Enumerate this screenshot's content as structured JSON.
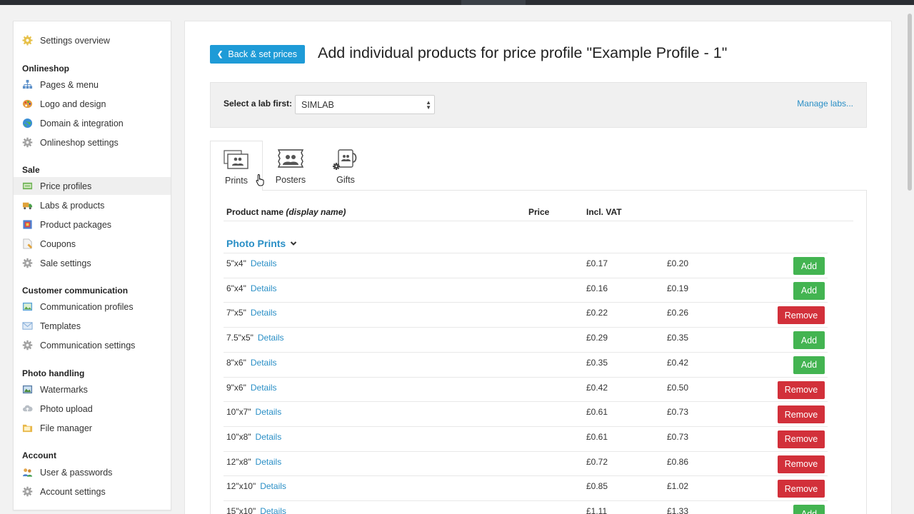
{
  "sidebar": {
    "overview": "Settings overview",
    "sections": {
      "onlineshop": "Onlineshop",
      "sale": "Sale",
      "customer_communication": "Customer communication",
      "photo_handling": "Photo handling",
      "account": "Account"
    },
    "items": {
      "pages_menu": "Pages & menu",
      "logo_design": "Logo and design",
      "domain_integration": "Domain & integration",
      "onlineshop_settings": "Onlineshop settings",
      "price_profiles": "Price profiles",
      "labs_products": "Labs & products",
      "product_packages": "Product packages",
      "coupons": "Coupons",
      "sale_settings": "Sale settings",
      "communication_profiles": "Communication profiles",
      "templates": "Templates",
      "communication_settings": "Communication settings",
      "watermarks": "Watermarks",
      "photo_upload": "Photo upload",
      "file_manager": "File manager",
      "user_passwords": "User & passwords",
      "account_settings": "Account settings"
    },
    "active_item": "Price profiles"
  },
  "header": {
    "back_label": "Back & set prices",
    "title": "Add individual products for price profile \"Example Profile - 1\""
  },
  "lab": {
    "label": "Select a lab first:",
    "selected": "SIMLAB",
    "manage_link": "Manage labs..."
  },
  "tabs": [
    {
      "label": "Prints",
      "active": true
    },
    {
      "label": "Posters",
      "active": false
    },
    {
      "label": "Gifts",
      "active": false
    }
  ],
  "table": {
    "col_product": "Product name",
    "col_product_hint": "(display name)",
    "col_price": "Price",
    "col_vat": "Incl. VAT",
    "category": "Photo Prints",
    "details_label": "Details",
    "add_label": "Add",
    "remove_label": "Remove",
    "rows": [
      {
        "name": "5\"x4\"",
        "price": "£0.17",
        "vat": "£0.20",
        "action": "Add"
      },
      {
        "name": "6\"x4\"",
        "price": "£0.16",
        "vat": "£0.19",
        "action": "Add"
      },
      {
        "name": "7\"x5\"",
        "price": "£0.22",
        "vat": "£0.26",
        "action": "Remove"
      },
      {
        "name": "7.5\"x5\"",
        "price": "£0.29",
        "vat": "£0.35",
        "action": "Add"
      },
      {
        "name": "8\"x6\"",
        "price": "£0.35",
        "vat": "£0.42",
        "action": "Add"
      },
      {
        "name": "9\"x6\"",
        "price": "£0.42",
        "vat": "£0.50",
        "action": "Remove"
      },
      {
        "name": "10\"x7\"",
        "price": "£0.61",
        "vat": "£0.73",
        "action": "Remove"
      },
      {
        "name": "10\"x8\"",
        "price": "£0.61",
        "vat": "£0.73",
        "action": "Remove"
      },
      {
        "name": "12\"x8\"",
        "price": "£0.72",
        "vat": "£0.86",
        "action": "Remove"
      },
      {
        "name": "12\"x10\"",
        "price": "£0.85",
        "vat": "£1.02",
        "action": "Remove"
      },
      {
        "name": "15\"x10\"",
        "price": "£1.11",
        "vat": "£1.33",
        "action": "Add"
      }
    ]
  },
  "colors": {
    "accent": "#1e9bd7",
    "link": "#2a8fc6",
    "add": "#43b451",
    "remove": "#d2303a"
  }
}
